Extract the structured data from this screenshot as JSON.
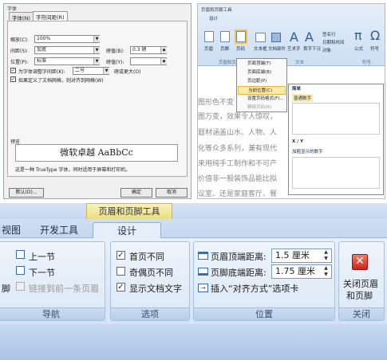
{
  "font_dialog": {
    "title": "字体",
    "tabs": [
      "字体(N)",
      "字符间距(R)"
    ],
    "rows": [
      {
        "label": "缩放(C):",
        "value": "100%"
      },
      {
        "label": "间距(S):",
        "value": "加宽",
        "extra_label": "磅值(B):",
        "extra_value": "0.3 磅"
      },
      {
        "label": "位置(P):",
        "value": "标准",
        "extra_label": "磅值(Y):",
        "extra_value": ""
      }
    ],
    "kerning_label": "为字体调整字间距(K):",
    "kerning_value": "二号",
    "kerning_suffix": "磅或更大(O)",
    "grid_label": "如果定义了文档网格，则对齐到网格(W)",
    "preview_label": "预览",
    "preview_text": "微软卓越 AaBbCc",
    "desc_text": "这是一种 TrueType 字体，同时适用于屏幕和打印机。",
    "default_button": "默认(D)...",
    "ok_button": "确定",
    "cancel_button": "取消"
  },
  "mini_ribbon": {
    "context_title": "页眉和页脚工具",
    "design_tab": "设计",
    "buttons": [
      "页眉",
      "页脚",
      "页码",
      "文本框",
      "文档部件",
      "艺术字",
      "首字下沉",
      "公式",
      "符号"
    ],
    "side_items": [
      "签名行",
      "日期和时间",
      "对象"
    ],
    "groups": [
      "页眉和页脚",
      "文本",
      "符号"
    ],
    "menu_items": [
      "页面顶端(T)",
      "页面底端(B)",
      "页边距(P)",
      "当前位置(C)",
      "设置页码格式(F)...",
      "删除页码(R)"
    ],
    "submenu_title": "简单",
    "submenu_item": "普通数字",
    "submenu2_title": "X / Y",
    "submenu2_item": "加粗显示的数字",
    "doc_lines": [
      "图形色不变",
      "图万变，效果令人惊叹，",
      "题材涵盖山水、人物、人",
      "化等众多系列，兼有现代",
      "来用纯手工制作和不可产",
      "价值非一般装饰品能比拟",
      "议室、还是家庭客厅、餐"
    ]
  },
  "big_ribbon": {
    "context_title": "页眉和页脚工具",
    "tabs": [
      "视图",
      "开发工具",
      "设计"
    ],
    "nav": {
      "prev": "上一节",
      "next": "下一节",
      "link": "链接到前一条页眉",
      "side_label": "脚",
      "group": "导航"
    },
    "options": {
      "items": [
        {
          "label": "首页不同",
          "checked": "✓"
        },
        {
          "label": "奇偶页不同",
          "checked": ""
        },
        {
          "label": "显示文档文字",
          "checked": "✓"
        }
      ],
      "group": "选项"
    },
    "position": {
      "header_label": "页眉顶端距离:",
      "header_value": "1.5 厘米",
      "footer_label": "页脚底端距离:",
      "footer_value": "1.75 厘米",
      "align_label": "插入“对齐方式”选项卡",
      "group": "位置"
    },
    "close": {
      "label_line1": "关闭页眉",
      "label_line2": "和页脚",
      "group": "关闭"
    }
  }
}
